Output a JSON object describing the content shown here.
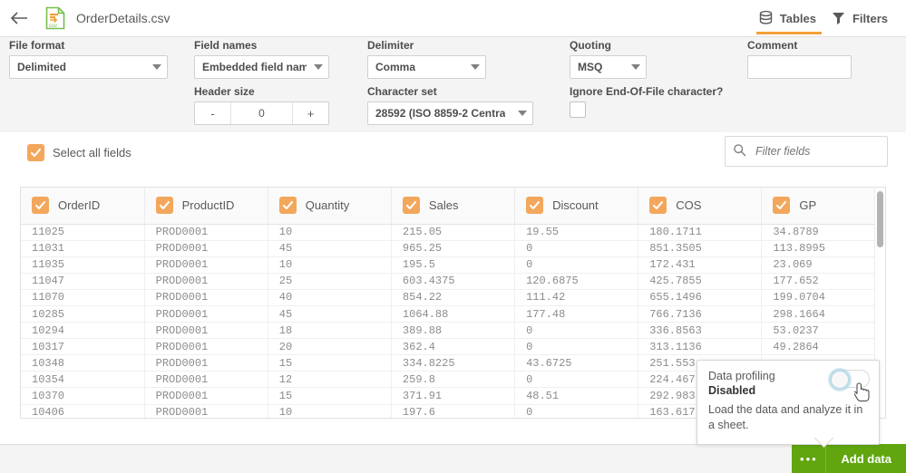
{
  "header": {
    "back_icon": "arrow-left-icon",
    "file_icon": "csv-file-icon",
    "file_name": "OrderDetails.csv",
    "tabs": [
      {
        "label": "Tables",
        "icon": "database-icon",
        "active": true
      },
      {
        "label": "Filters",
        "icon": "funnel-icon",
        "active": false
      }
    ]
  },
  "settings": {
    "file_format": {
      "label": "File format",
      "value": "Delimited"
    },
    "field_names": {
      "label": "Field names",
      "value": "Embedded field name"
    },
    "delimiter": {
      "label": "Delimiter",
      "value": "Comma"
    },
    "quoting": {
      "label": "Quoting",
      "value": "MSQ"
    },
    "comment": {
      "label": "Comment",
      "value": "",
      "placeholder": ""
    },
    "header_size": {
      "label": "Header size",
      "value": "0",
      "minus": "-",
      "plus": "+"
    },
    "character_set": {
      "label": "Character set",
      "value": "28592 (ISO 8859-2 Centra"
    },
    "ignore_eof": {
      "label": "Ignore End-Of-File character?",
      "checked": false
    }
  },
  "fields": {
    "select_all_label": "Select all fields",
    "select_all_checked": true,
    "filter_placeholder": "Filter fields",
    "filter_value": "",
    "search_icon": "search-icon"
  },
  "table": {
    "columns": [
      {
        "name": "OrderID",
        "checked": true
      },
      {
        "name": "ProductID",
        "checked": true
      },
      {
        "name": "Quantity",
        "checked": true
      },
      {
        "name": "Sales",
        "checked": true
      },
      {
        "name": "Discount",
        "checked": true
      },
      {
        "name": "COS",
        "checked": true
      },
      {
        "name": "GP",
        "checked": true
      }
    ],
    "rows": [
      [
        "11025",
        "PROD0001",
        "10",
        "215.05",
        "19.55",
        "180.1711",
        "34.8789"
      ],
      [
        "11031",
        "PROD0001",
        "45",
        "965.25",
        "0",
        "851.3505",
        "113.8995"
      ],
      [
        "11035",
        "PROD0001",
        "10",
        "195.5",
        "0",
        "172.431",
        "23.069"
      ],
      [
        "11047",
        "PROD0001",
        "25",
        "603.4375",
        "120.6875",
        "425.7855",
        "177.652"
      ],
      [
        "11070",
        "PROD0001",
        "40",
        "854.22",
        "111.42",
        "655.1496",
        "199.0704"
      ],
      [
        "10285",
        "PROD0001",
        "45",
        "1064.88",
        "177.48",
        "766.7136",
        "298.1664"
      ],
      [
        "10294",
        "PROD0001",
        "18",
        "389.88",
        "0",
        "336.8563",
        "53.0237"
      ],
      [
        "10317",
        "PROD0001",
        "20",
        "362.4",
        "0",
        "313.1136",
        "49.2864"
      ],
      [
        "10348",
        "PROD0001",
        "15",
        "334.8225",
        "43.6725",
        "251.553",
        ""
      ],
      [
        "10354",
        "PROD0001",
        "12",
        "259.8",
        "0",
        "224.467",
        ""
      ],
      [
        "10370",
        "PROD0001",
        "15",
        "371.91",
        "48.51",
        "292.983",
        ""
      ],
      [
        "10406",
        "PROD0001",
        "10",
        "197.6",
        "0",
        "163.617",
        ""
      ]
    ]
  },
  "popup": {
    "title": "Data profiling",
    "state": "Disabled",
    "description": "Load the data and analyze it in a sheet.",
    "toggle_on": false
  },
  "footer": {
    "more_label": "•••",
    "add_data_label": "Add data"
  },
  "colors": {
    "accent_orange": "#f3a75c",
    "tab_underline": "#f2a139",
    "add_data_green": "#61a60e",
    "panel_gray": "#f4f4f4",
    "text_gray": "#595959"
  }
}
